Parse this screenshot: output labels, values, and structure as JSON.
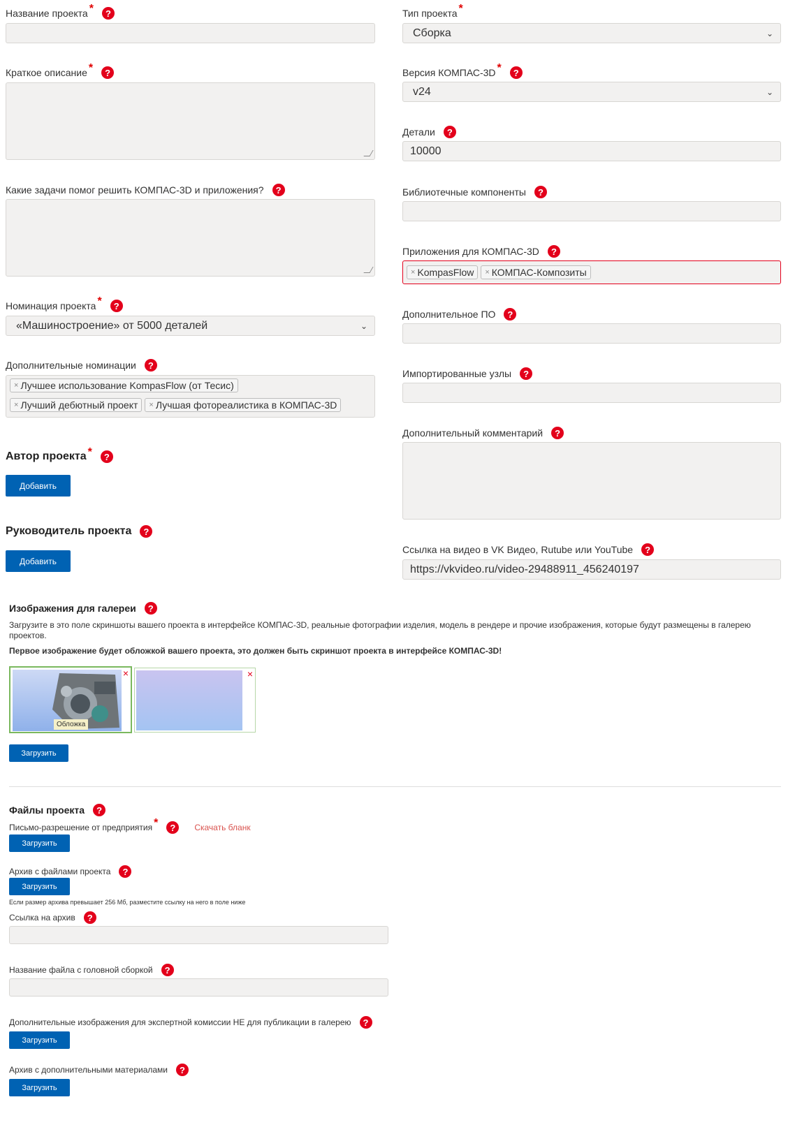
{
  "left": {
    "project_name": {
      "label": "Название проекта",
      "value": ""
    },
    "short_desc": {
      "label": "Краткое описание",
      "value": ""
    },
    "tasks": {
      "label": "Какие задачи помог решить КОМПАС-3D и приложения?",
      "value": ""
    },
    "nomination": {
      "label": "Номинация проекта",
      "value": "«Машиностроение» от 5000 деталей"
    },
    "extra_nominations": {
      "label": "Дополнительные номинации",
      "tags": [
        "Лучшее использование KompasFlow (от Тесис)",
        "Лучший дебютный проект",
        "Лучшая фотореалистика в КОМПАС-3D"
      ]
    },
    "author": {
      "title": "Автор проекта",
      "button": "Добавить"
    },
    "manager": {
      "title": "Руководитель проекта",
      "button": "Добавить"
    }
  },
  "right": {
    "project_type": {
      "label": "Тип проекта",
      "value": "Сборка"
    },
    "kompas_version": {
      "label": "Версия КОМПАС-3D",
      "value": "v24"
    },
    "details": {
      "label": "Детали",
      "value": "10000"
    },
    "library": {
      "label": "Библиотечные компоненты",
      "value": ""
    },
    "apps": {
      "label": "Приложения для КОМПАС-3D",
      "tags": [
        "KompasFlow",
        "КОМПАС-Композиты"
      ]
    },
    "extra_software": {
      "label": "Дополнительное ПО",
      "value": ""
    },
    "imported_nodes": {
      "label": "Импортированные узлы",
      "value": ""
    },
    "extra_comment": {
      "label": "Дополнительный комментарий",
      "value": ""
    },
    "video_link": {
      "label": "Ссылка на видео в VK Видео, Rutube или YouTube",
      "value": "https://vkvideo.ru/video-29488911_456240197"
    }
  },
  "gallery": {
    "title": "Изображения для галереи",
    "desc": "Загрузите в это поле скриншоты вашего проекта в интерфейсе КОМПАС-3D, реальные фотографии изделия, модель в рендере и прочие изображения, которые будут размещены в галерею проектов.",
    "note": "Первое изображение будет обложкой вашего проекта, это должен быть скриншот проекта в интерфейсе КОМПАС-3D!",
    "cover_badge": "Обложка",
    "close": "×",
    "upload": "Загрузить"
  },
  "files": {
    "title": "Файлы проекта",
    "letter": {
      "label": "Письмо-разрешение от предприятия",
      "link": "Скачать бланк",
      "button": "Загрузить"
    },
    "archive": {
      "label": "Архив с файлами проекта",
      "button": "Загрузить",
      "hint": "Если размер архива превышает 256 Мб, разместите ссылку на него в поле ниже"
    },
    "archive_link": {
      "label": "Ссылка на архив",
      "value": ""
    },
    "main_assembly": {
      "label": "Название файла с головной сборкой",
      "value": ""
    },
    "extra_images": {
      "label": "Дополнительные изображения для экспертной комиссии НЕ для публикации в галерею",
      "button": "Загрузить"
    },
    "extra_archive": {
      "label": "Архив с дополнительными материалами",
      "button": "Загрузить"
    }
  },
  "common": {
    "required_mark": "*",
    "help_mark": "?",
    "tag_remove": "×",
    "chevron": "⌄"
  },
  "colors": {
    "primary_button": "#0062b3",
    "help_icon": "#e3001b",
    "input_bg": "#f2f1f0",
    "error_border": "#e3001b"
  }
}
